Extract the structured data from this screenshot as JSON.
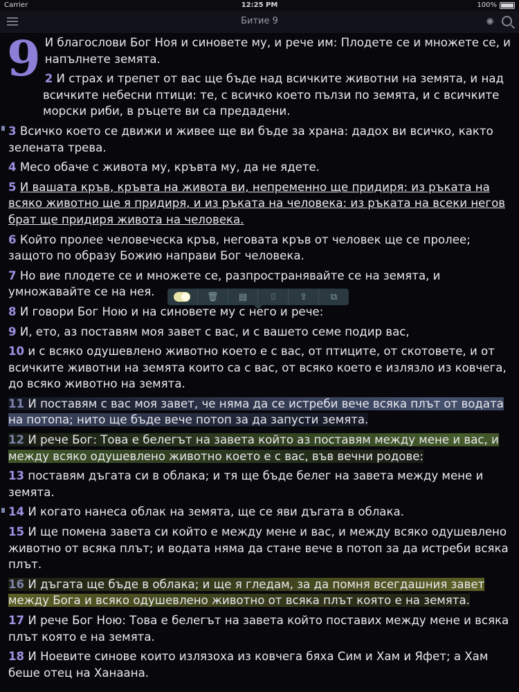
{
  "status_bar": {
    "carrier": "Carrier",
    "time": "12:25 PM",
    "battery": "100%"
  },
  "navbar": {
    "title": "Битие 9",
    "menu_icon": "menu-icon",
    "brightness_icon": "brightness-icon",
    "search_icon": "search-icon"
  },
  "chapter": "9",
  "verses": [
    {
      "num": "",
      "text": "И благослови Бог Ноя и синовете му, и рече им: Плодете се и множете се, и напълнете земята."
    },
    {
      "num": "2",
      "text": "И страх и трепет от вас ще бъде над всичките животни на земята, и над всичките небесни птици: те, с всичко което пълзи по земята, и с всичките морски риби, в ръцете ви са предадени."
    },
    {
      "num": "3",
      "text": "Всичко което се движи и живее ще ви бъде за храна: дадох ви всичко, както зелената трева."
    },
    {
      "num": "4",
      "text": "Месо обаче с живота му, кръвта му, да не ядете."
    },
    {
      "num": "5",
      "text": "И вашата кръв, кръвта на живота ви, непременно ще придиря: из ръката на всяко животно ще я придиря, и из ръката на человека: из ръката на всеки негов брат ще придиря живота на человека."
    },
    {
      "num": "6",
      "text": "Който пролее человеческа кръв, неговата кръв от человек ще се пролее; защото по образу Божию направи Бог человека."
    },
    {
      "num": "7",
      "text": "Но вие плодете се и множете се, разпространявайте се на земята, и умножавайте се на нея."
    },
    {
      "num": "8",
      "text": "И говори Бог Ною и на синовете му с него и рече:"
    },
    {
      "num": "9",
      "text": "И, ето, аз поставям моя завет с вас, и с вашето семе подир вас,"
    },
    {
      "num": "10",
      "text": "и с всяко одушевлено животно което е с вас, от птиците, от скотовете, и от всичките животни на земята които са с вас, от всяко което е излязло из ковчега, до всяко животно на земята."
    },
    {
      "num": "11",
      "text": "И поставям с вас моя завет, че няма да се истреби вече всяка плът от водата на потопа; нито ще бъде вече потоп за да запусти земята."
    },
    {
      "num": "12",
      "text": "И рече Бог: Това е белегът на завета който аз поставям между мене и вас, и между всяко одушевлено животно което е с вас, във вечни родове:"
    },
    {
      "num": "13",
      "text": "поставям дъгата си в облака; и тя ще бъде белег на завета между мене и земята."
    },
    {
      "num": "14",
      "text": "И когато нанеса облак на земята, ще се яви дъгата в облака."
    },
    {
      "num": "15",
      "text": "И ще помена завета си който е между мене и вас, и между всяко одушевлено животно от всяка плът; и водата няма да стане вече в потоп за да истреби всяка плът."
    },
    {
      "num": "16",
      "text": "И дъгата ще бъде в облака; и ще я гледам, за да помня всегдашния завет между Бога и всяко одушевлено животно от всяка плът която е на земята."
    },
    {
      "num": "17",
      "text": "И рече Бог Ною: Това е белегът на завета който поставих между мене и всяка плът която е на земята."
    },
    {
      "num": "18",
      "text": "И Ноевите синове които излязоха из ковчега бяха Сим и Хам и Яфет; а Хам беше отец на Ханаана."
    }
  ],
  "toolbar": {
    "buttons": [
      "highlight-toggle-icon",
      "trash-icon",
      "note-icon",
      "bookmark-icon",
      "share-icon",
      "copy-icon"
    ]
  },
  "colors": {
    "background": "#07070c",
    "verse_number": "#9d90e0",
    "highlight_blue": "#7a8cc0",
    "highlight_green": "#78a046",
    "highlight_olive": "#a0aa3c"
  }
}
